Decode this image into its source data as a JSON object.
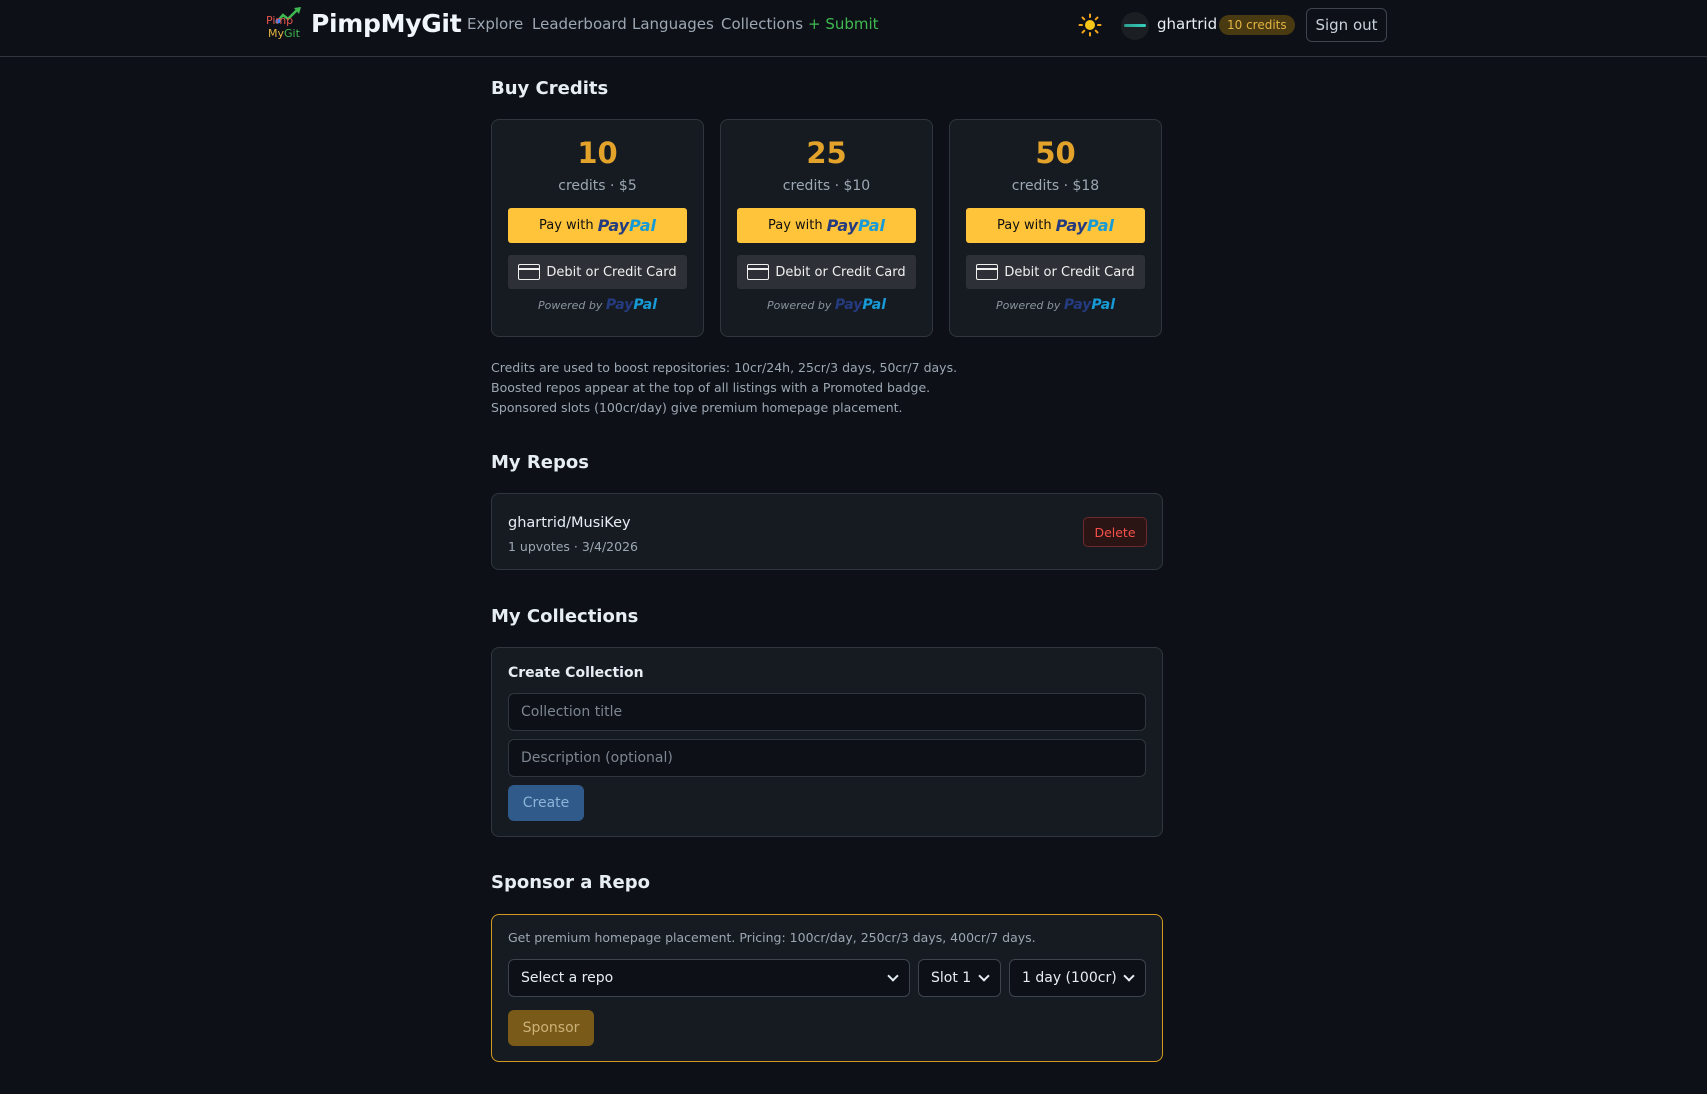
{
  "header": {
    "logo_line1": "Pimp",
    "logo_line2a": "My",
    "logo_line2b": "Git",
    "brand": "PimpMyGit",
    "nav": [
      "Explore",
      "Leaderboard",
      "Languages",
      "Collections",
      "+ Submit"
    ],
    "theme_icon": "sun-icon",
    "username": "ghartrid",
    "credits_badge": "10 credits",
    "signout": "Sign out"
  },
  "buy_credits": {
    "title": "Buy Credits",
    "packages": [
      {
        "amount": "10",
        "price": "credits · $5"
      },
      {
        "amount": "25",
        "price": "credits · $10"
      },
      {
        "amount": "50",
        "price": "credits · $18"
      }
    ],
    "pay_with": "Pay with",
    "paypal_p1": "Pay",
    "paypal_p2": "Pal",
    "card_button": "Debit or Credit Card",
    "powered_by": "Powered by",
    "info": [
      "Credits are used to boost repositories: 10cr/24h, 25cr/3 days, 50cr/7 days.",
      "Boosted repos appear at the top of all listings with a Promoted badge.",
      "Sponsored slots (100cr/day) give premium homepage placement."
    ]
  },
  "my_repos": {
    "title": "My Repos",
    "repo_name": "ghartrid/MusiKey",
    "repo_meta": "1 upvotes · 3/4/2026",
    "delete": "Delete"
  },
  "my_collections": {
    "title": "My Collections",
    "create_label": "Create Collection",
    "title_placeholder": "Collection title",
    "desc_placeholder": "Description (optional)",
    "create_button": "Create"
  },
  "sponsor": {
    "title": "Sponsor a Repo",
    "description": "Get premium homepage placement. Pricing: 100cr/day, 250cr/3 days, 400cr/7 days.",
    "repo_select": "Select a repo",
    "slot_select": "Slot 1",
    "duration_select": "1 day (100cr)",
    "button": "Sponsor"
  }
}
